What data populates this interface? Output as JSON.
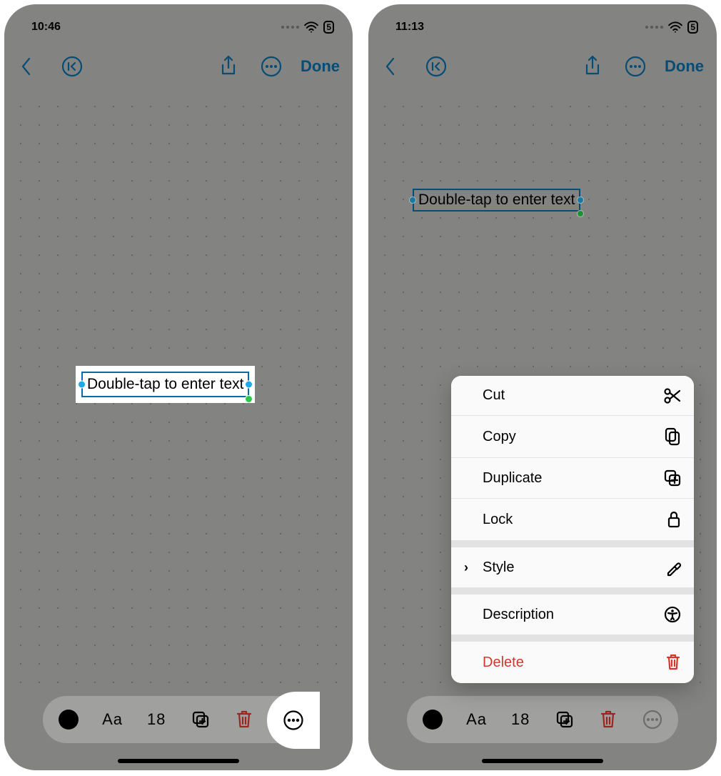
{
  "screens": [
    {
      "status": {
        "time": "10:46",
        "battery": "5"
      },
      "nav": {
        "done_label": "Done"
      },
      "textbox": {
        "placeholder": "Double-tap to enter text"
      },
      "toolbar": {
        "font_button": "Aa",
        "font_size": "18"
      }
    },
    {
      "status": {
        "time": "11:13",
        "battery": "5"
      },
      "nav": {
        "done_label": "Done"
      },
      "textbox": {
        "placeholder": "Double-tap to enter text"
      },
      "toolbar": {
        "font_button": "Aa",
        "font_size": "18"
      },
      "context_menu": {
        "cut": "Cut",
        "copy": "Copy",
        "duplicate": "Duplicate",
        "lock": "Lock",
        "style": "Style",
        "description": "Description",
        "delete": "Delete"
      }
    }
  ]
}
